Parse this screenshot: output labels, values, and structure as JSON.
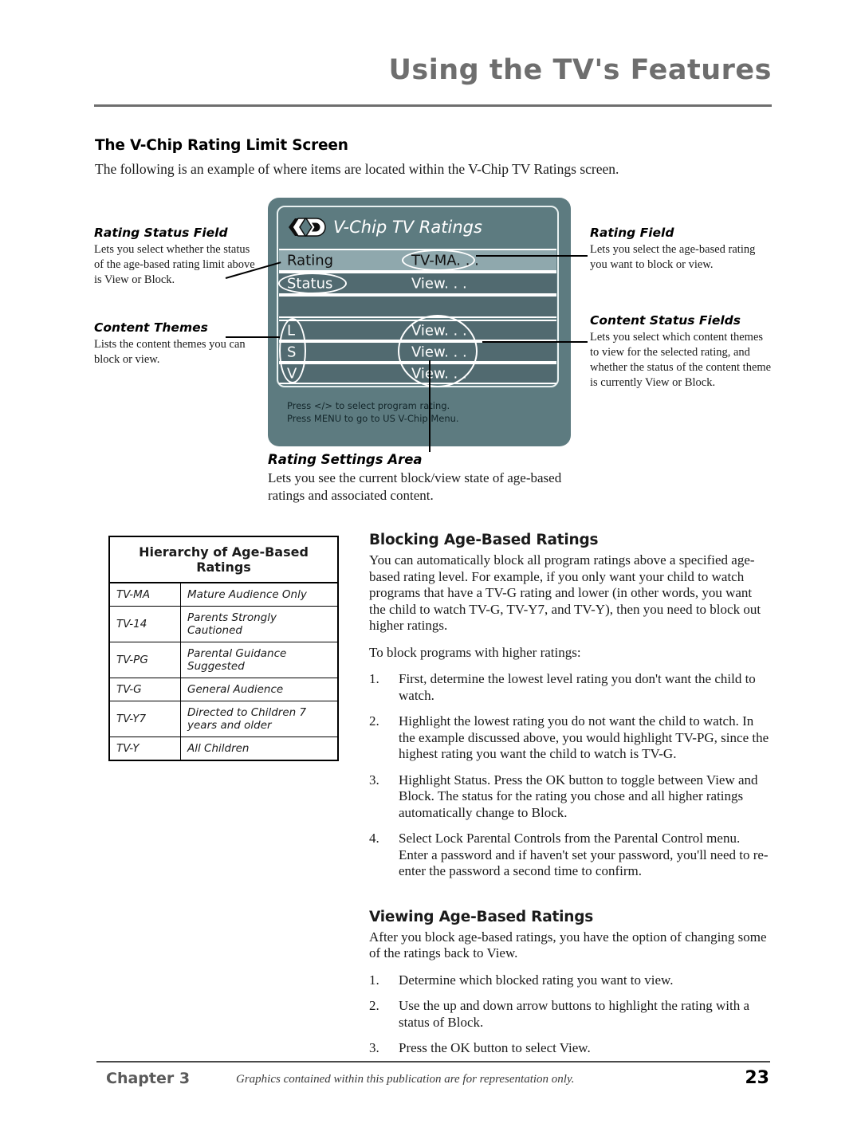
{
  "header": {
    "title": "Using the TV's Features"
  },
  "section1": {
    "heading": "The V-Chip Rating Limit Screen",
    "intro": "The following is an example of where items are located within the V-Chip TV Ratings screen."
  },
  "tv_screen": {
    "logo_icon": "v-chip-logo-icon",
    "title": "V-Chip TV Ratings",
    "rows": [
      {
        "label": "Rating",
        "value": "TV-MA. . ."
      },
      {
        "label": "Status",
        "value": "View. . ."
      },
      {
        "label": "",
        "value": ""
      },
      {
        "label": "L",
        "value": "View. . ."
      },
      {
        "label": "S",
        "value": "View. . ."
      },
      {
        "label": "V",
        "value": "View. . ."
      }
    ],
    "help_line1": "Press </> to select program rating.",
    "help_line2": "Press MENU to go to US V-Chip Menu.",
    "colors": {
      "bezel": "#5d7b80",
      "row_dark": "#516a70",
      "row_highlight": "#8fa8ad",
      "text": "#ffffff"
    }
  },
  "annotations": {
    "rating_status_field": {
      "title": "Rating Status Field",
      "body": "Lets you select whether the status of the age-based rating limit above is View or Block."
    },
    "content_themes": {
      "title": "Content Themes",
      "body": "Lists the content themes you can block or view."
    },
    "rating_field": {
      "title": "Rating Field",
      "body": "Lets you select the age-based rating you want to block or view."
    },
    "content_status_fields": {
      "title": "Content Status Fields",
      "body": "Lets you select which content themes to view for the selected rating, and whether the status of the content theme is currently View or Block."
    },
    "rating_settings_area": {
      "title": "Rating Settings Area",
      "body": "Lets you see the current block/view state of age-based ratings and associated content."
    }
  },
  "hierarchy_table": {
    "title": "Hierarchy of Age-Based Ratings",
    "rows": [
      {
        "code": "TV-MA",
        "desc": "Mature Audience Only"
      },
      {
        "code": "TV-14",
        "desc": "Parents Strongly Cautioned"
      },
      {
        "code": "TV-PG",
        "desc": "Parental Guidance Suggested"
      },
      {
        "code": "TV-G",
        "desc": "General Audience"
      },
      {
        "code": "TV-Y7",
        "desc": "Directed to Children 7 years and older"
      },
      {
        "code": "TV-Y",
        "desc": "All Children"
      }
    ]
  },
  "blocking": {
    "heading": "Blocking Age-Based Ratings",
    "para1": "You can automatically block all program ratings above a specified age-based rating level. For example, if you only want your child to watch programs that have a TV-G rating and lower (in other words, you want the child to watch TV-G, TV-Y7, and TV-Y), then you need to block out higher ratings.",
    "para2": "To block programs with higher ratings:",
    "steps": [
      {
        "num": "1.",
        "text": "First, determine the lowest level rating you don't want the child to watch."
      },
      {
        "num": "2.",
        "text": "Highlight the lowest rating you do not want the child to watch. In the example discussed above, you would highlight TV-PG, since the highest rating you want the child to watch is TV-G."
      },
      {
        "num": "3.",
        "text": "Highlight Status. Press the OK button to toggle between View and Block. The status for the rating you chose and all higher ratings automatically change to Block."
      },
      {
        "num": "4.",
        "text": "Select Lock Parental Controls from the Parental Control menu. Enter a password and if haven't set your password, you'll need to re-enter the password a second time to confirm."
      }
    ]
  },
  "viewing": {
    "heading": "Viewing Age-Based Ratings",
    "para1": "After you block age-based ratings, you have the option of changing some of the ratings back to View.",
    "steps": [
      {
        "num": "1.",
        "text": "Determine which blocked rating you want to view."
      },
      {
        "num": "2.",
        "text": "Use the up and down arrow buttons to highlight the rating with a status of Block."
      },
      {
        "num": "3.",
        "text": "Press the OK button to select View."
      }
    ]
  },
  "footer": {
    "chapter": "Chapter 3",
    "note": "Graphics contained within this publication are for representation only.",
    "page": "23"
  }
}
